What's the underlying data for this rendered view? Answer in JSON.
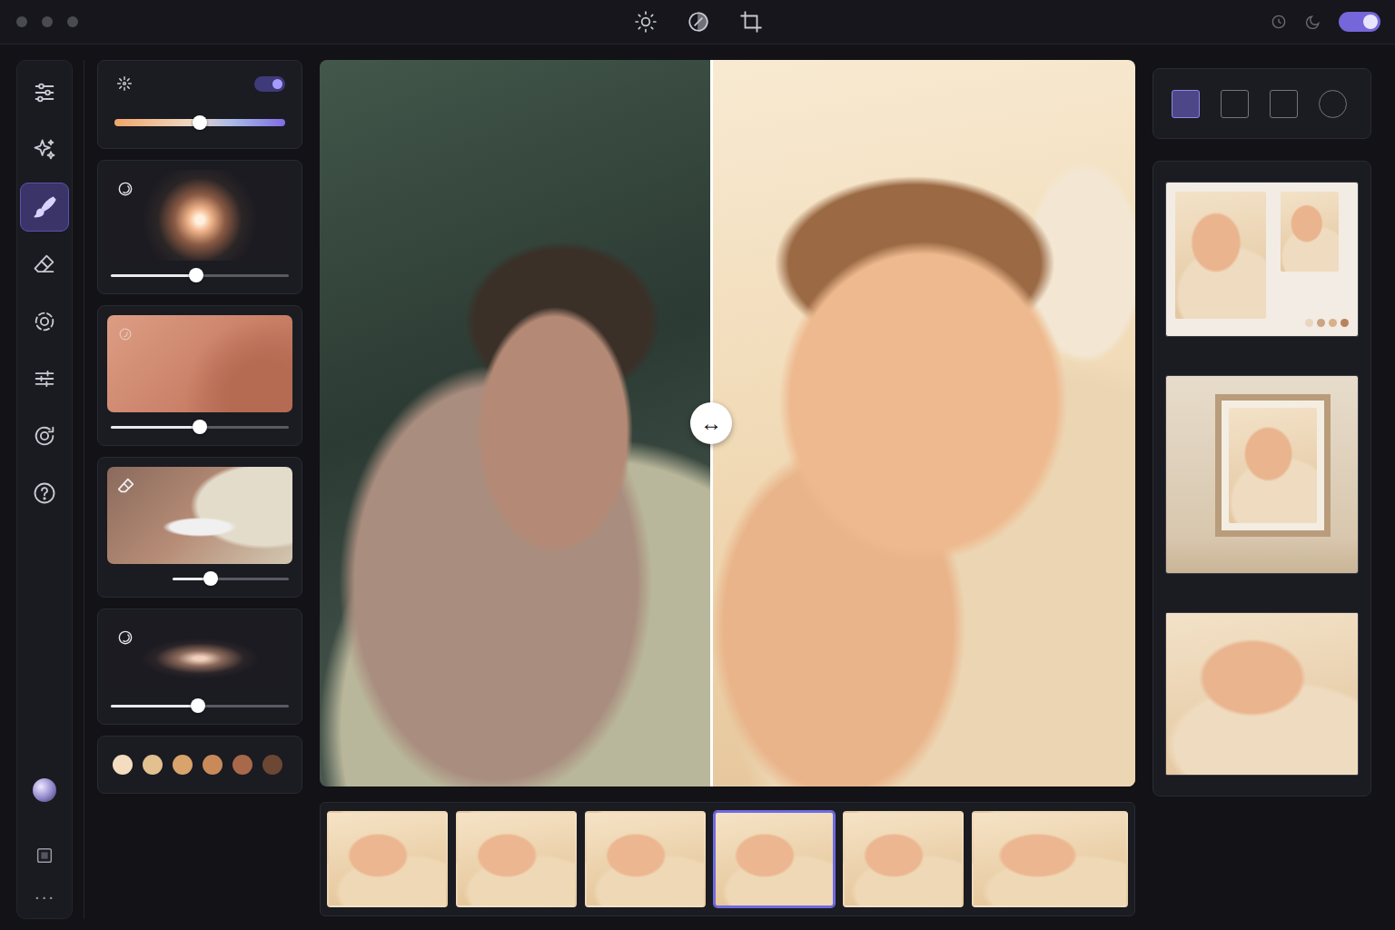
{
  "theme_toggle": {
    "on": true
  },
  "rail": {
    "items": [
      {
        "selected": false
      },
      {
        "selected": false
      },
      {
        "selected": true
      },
      {
        "selected": false
      },
      {
        "selected": false
      },
      {
        "selected": false
      },
      {
        "selected": false
      },
      {
        "selected": false
      }
    ],
    "more": "···"
  },
  "enhance": {
    "on": true,
    "level": 0.5
  },
  "adjustments": [
    {
      "kind": "glow",
      "level": 0.48
    },
    {
      "kind": "texture",
      "level": 0.5
    },
    {
      "kind": "erase",
      "level": 0.33
    },
    {
      "kind": "vignette",
      "level": 0.49
    }
  ],
  "swatches": [
    {
      "color": "#f3dcc0"
    },
    {
      "color": "#e3c08f"
    },
    {
      "color": "#d9a46c"
    },
    {
      "color": "#c98a5a"
    },
    {
      "color": "#a8694a"
    },
    {
      "color": "#6b4734"
    }
  ],
  "compare": {
    "split": 0.48,
    "handle": "↔"
  },
  "filmstrip": [
    {
      "selected": false
    },
    {
      "selected": false
    },
    {
      "selected": false
    },
    {
      "selected": true
    },
    {
      "selected": false
    },
    {
      "selected": false
    }
  ],
  "shapes": [
    {
      "kind": "square",
      "selected": true
    },
    {
      "kind": "square",
      "selected": false
    },
    {
      "kind": "square",
      "selected": false
    },
    {
      "kind": "circle",
      "selected": false
    }
  ],
  "previews": [
    {
      "kind": "collage",
      "dots": [
        {
          "color": "#e9d6bf"
        },
        {
          "color": "#c9a586"
        },
        {
          "color": "#d8b08a"
        },
        {
          "color": "#b7825d"
        }
      ]
    },
    {
      "kind": "frame"
    },
    {
      "kind": "plain"
    }
  ]
}
